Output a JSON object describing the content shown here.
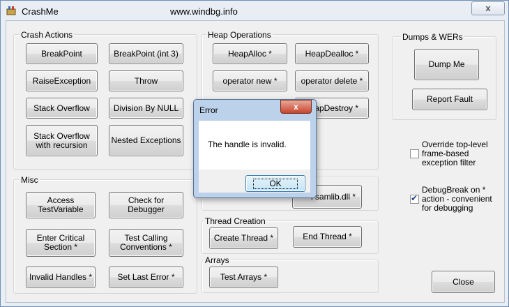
{
  "window": {
    "title": "CrashMe",
    "url": "www.windbg.info",
    "close_glyph": "x"
  },
  "groups": {
    "crash_actions": "Crash Actions",
    "heap_operations": "Heap Operations",
    "dumps_wers": "Dumps & WERs",
    "misc": "Misc",
    "thread_creation": "Thread Creation",
    "arrays": "Arrays"
  },
  "crash_actions": {
    "breakpoint": "BreakPoint",
    "breakpoint_int3": "BreakPoint (int 3)",
    "raise_exception": "RaiseException",
    "throw": "Throw",
    "stack_overflow": "Stack Overflow",
    "division_by_null": "Division By NULL",
    "stack_overflow_recursion": "Stack Overflow\nwith recursion",
    "nested_exceptions": "Nested Exceptions"
  },
  "heap_operations": {
    "heap_alloc": "HeapAlloc *",
    "heap_dealloc": "HeapDealloc *",
    "operator_new": "operator new *",
    "operator_delete": "operator delete *",
    "heap_destroy": "eapDestroy *",
    "samlib": "l samlib.dll *"
  },
  "dumps": {
    "dump_me": "Dump Me",
    "report_fault": "Report Fault"
  },
  "misc": {
    "access_test_variable": "Access\nTestVariable",
    "check_for_debugger": "Check for Debugger",
    "enter_critical_section": "Enter Critical\nSection *",
    "test_calling_conventions": "Test Calling\nConventions *",
    "invalid_handles": "Invalid Handles *",
    "set_last_error": "Set Last Error *"
  },
  "threads": {
    "create_thread": "Create Thread *",
    "end_thread": "End Thread *"
  },
  "arrays": {
    "test_arrays": "Test Arrays *"
  },
  "options": {
    "override_filter": {
      "label": "Override top-level\nframe-based\nexception filter",
      "checked": false
    },
    "debugbreak": {
      "label": "DebugBreak on *\naction - convenient\nfor debugging",
      "checked": true
    }
  },
  "close_button": "Close",
  "error_dialog": {
    "title": "Error",
    "message": "The handle is invalid.",
    "ok_label": "OK",
    "close_glyph": "x"
  }
}
